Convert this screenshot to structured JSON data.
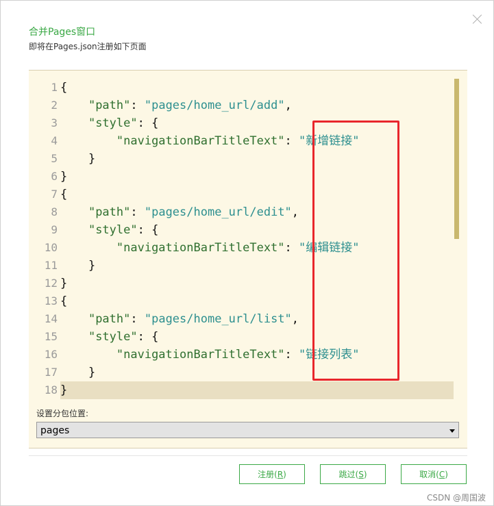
{
  "dialog": {
    "title": "合并Pages窗口",
    "subtitle": "即将在Pages.json注册如下页面"
  },
  "code": [
    {
      "n": "1",
      "parts": [
        [
          "",
          "{"
        ]
      ]
    },
    {
      "n": "2",
      "parts": [
        [
          "",
          "    "
        ],
        [
          "key",
          "\"path\""
        ],
        [
          "",
          ": "
        ],
        [
          "str",
          "\"pages/home_url/add\""
        ],
        [
          "",
          ","
        ]
      ]
    },
    {
      "n": "3",
      "parts": [
        [
          "",
          "    "
        ],
        [
          "key",
          "\"style\""
        ],
        [
          "",
          ": {"
        ]
      ]
    },
    {
      "n": "4",
      "parts": [
        [
          "",
          "        "
        ],
        [
          "key",
          "\"navigationBarTitleText\""
        ],
        [
          "",
          ": "
        ],
        [
          "str",
          "\"新增链接\""
        ]
      ]
    },
    {
      "n": "5",
      "parts": [
        [
          "",
          "    }"
        ]
      ]
    },
    {
      "n": "6",
      "parts": [
        [
          "",
          "}"
        ]
      ]
    },
    {
      "n": "7",
      "parts": [
        [
          "",
          "{"
        ]
      ]
    },
    {
      "n": "8",
      "parts": [
        [
          "",
          "    "
        ],
        [
          "key",
          "\"path\""
        ],
        [
          "",
          ": "
        ],
        [
          "str",
          "\"pages/home_url/edit\""
        ],
        [
          "",
          ","
        ]
      ]
    },
    {
      "n": "9",
      "parts": [
        [
          "",
          "    "
        ],
        [
          "key",
          "\"style\""
        ],
        [
          "",
          ": {"
        ]
      ]
    },
    {
      "n": "10",
      "parts": [
        [
          "",
          "        "
        ],
        [
          "key",
          "\"navigationBarTitleText\""
        ],
        [
          "",
          ": "
        ],
        [
          "str",
          "\"编辑链接\""
        ]
      ]
    },
    {
      "n": "11",
      "parts": [
        [
          "",
          "    }"
        ]
      ]
    },
    {
      "n": "12",
      "parts": [
        [
          "",
          "}"
        ]
      ]
    },
    {
      "n": "13",
      "parts": [
        [
          "",
          "{"
        ]
      ]
    },
    {
      "n": "14",
      "parts": [
        [
          "",
          "    "
        ],
        [
          "key",
          "\"path\""
        ],
        [
          "",
          ": "
        ],
        [
          "str",
          "\"pages/home_url/list\""
        ],
        [
          "",
          ","
        ]
      ]
    },
    {
      "n": "15",
      "parts": [
        [
          "",
          "    "
        ],
        [
          "key",
          "\"style\""
        ],
        [
          "",
          ": {"
        ]
      ]
    },
    {
      "n": "16",
      "parts": [
        [
          "",
          "        "
        ],
        [
          "key",
          "\"navigationBarTitleText\""
        ],
        [
          "",
          ": "
        ],
        [
          "str",
          "\"链接列表\""
        ]
      ]
    },
    {
      "n": "17",
      "parts": [
        [
          "",
          "    }"
        ]
      ]
    },
    {
      "n": "18",
      "parts": [
        [
          "",
          "}"
        ]
      ]
    }
  ],
  "subpackage": {
    "label": "设置分包位置:",
    "selected": "pages"
  },
  "buttons": {
    "register": "注册",
    "register_key": "R",
    "skip": "跳过",
    "skip_key": "S",
    "cancel": "取消",
    "cancel_key": "C"
  },
  "watermark": "CSDN @周国波",
  "colors": {
    "accent": "#3aa845",
    "annotation": "#e8262b"
  }
}
